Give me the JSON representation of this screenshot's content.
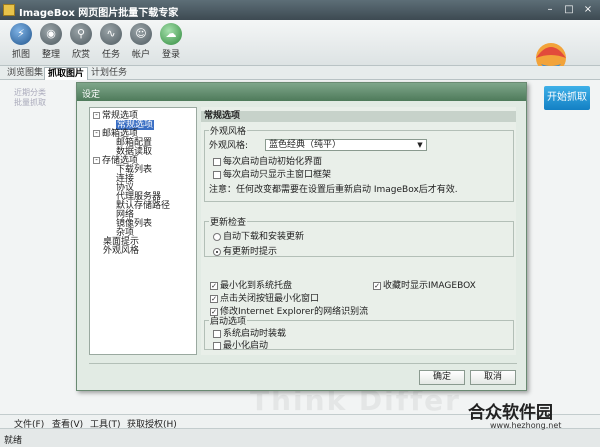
{
  "window": {
    "title": "ImageBox 网页图片批量下载专家"
  },
  "toolbar": {
    "items": [
      {
        "label": "抓图",
        "icon": "bolt-icon"
      },
      {
        "label": "整理",
        "icon": "disc-icon"
      },
      {
        "label": "欣赏",
        "icon": "magnifier-icon"
      },
      {
        "label": "任务",
        "icon": "wave-icon"
      },
      {
        "label": "帐户",
        "icon": "person-icon"
      },
      {
        "label": "登录",
        "icon": "cloud-icon"
      }
    ]
  },
  "tabs": [
    "浏览图集",
    "抓取图片",
    "计划任务"
  ],
  "main": {
    "side_faint": [
      "近期分类",
      "批量抓取"
    ],
    "start_button": "开始抓取",
    "watermark": "Think Differ"
  },
  "menubar": [
    "文件(F)",
    "查看(V)",
    "工具(T)",
    "获取授权(H)"
  ],
  "status": "就绪",
  "brand": {
    "name": "合众软件园",
    "url": "www.hezhong.net"
  },
  "dialog": {
    "title": "设定",
    "tree": [
      {
        "label": "常规选项",
        "level": 0,
        "expander": "-"
      },
      {
        "label": "常规选项",
        "level": 1,
        "selected": true
      },
      {
        "label": "邮箱选项",
        "level": 0,
        "expander": "-"
      },
      {
        "label": "邮箱配置",
        "level": 1
      },
      {
        "label": "数据读取",
        "level": 1
      },
      {
        "label": "存储选项",
        "level": 0,
        "expander": "-"
      },
      {
        "label": "下载列表",
        "level": 1
      },
      {
        "label": "连接",
        "level": 1
      },
      {
        "label": "协议",
        "level": 1
      },
      {
        "label": "代理服务器",
        "level": 1
      },
      {
        "label": "默认存储路径",
        "level": 1
      },
      {
        "label": "网络",
        "level": 1
      },
      {
        "label": "镜像列表",
        "level": 1
      },
      {
        "label": "杂项",
        "level": 1
      },
      {
        "label": "桌面提示",
        "level": 0
      },
      {
        "label": "外观风格",
        "level": 0
      }
    ],
    "panel_title": "常规选项",
    "appearance": {
      "group": "外观风格",
      "field_label": "外观风格:",
      "selected": "蓝色经典（纯平）",
      "check1": "每次启动自动初始化界面",
      "check2": "每次启动只显示主窗口框架",
      "note": "注意：任何改变都需要在设置后重新启动 ImageBox后才有效."
    },
    "update": {
      "group": "更新检查",
      "radio1": "自动下载和安装更新",
      "radio2": "有更新时提示"
    },
    "options": {
      "min_tray": "最小化到系统托盘",
      "close_min": "点击关闭按钮最小化窗口",
      "ie_stream": "修改Internet Explorer的网络识别流",
      "collect_show": "收藏时显示IMAGEBOX"
    },
    "startup": {
      "group": "启动选项",
      "auto_start": "系统启动时装载",
      "min_start": "最小化启动"
    },
    "ok": "确定",
    "cancel": "取消"
  }
}
